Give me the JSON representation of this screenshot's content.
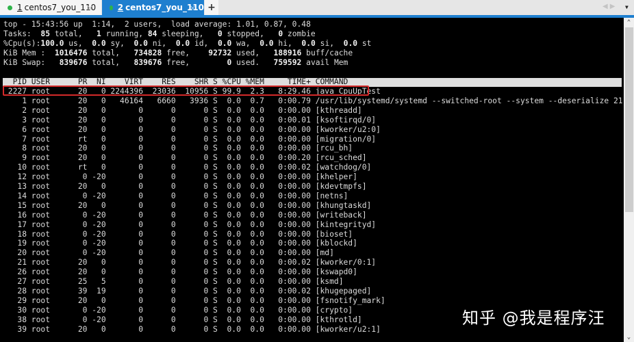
{
  "tabs": [
    {
      "number": "1",
      "label": " centos7_you_110",
      "active": false,
      "close": "×"
    },
    {
      "number": "2",
      "label": " centos7_you_110",
      "active": true,
      "close": "×"
    }
  ],
  "new_tab_label": "+",
  "nav_arrows": "◀▶",
  "menu_caret": "▼",
  "summary": {
    "line1": "top - 15:43:56 up  1:14,  2 users,  load average: 1.01, 0.87, 0.48",
    "tasks": {
      "label": "Tasks: ",
      "total": " 85",
      "total_l": " total, ",
      "running": "  1",
      "running_l": " running, ",
      "sleeping": "84",
      "sleeping_l": " sleeping, ",
      "stopped": "  0",
      "stopped_l": " stopped, ",
      "zombie": "  0",
      "zombie_l": " zombie"
    },
    "cpu": {
      "label": "%Cpu(s):",
      "us": "100.0",
      "us_l": " us, ",
      "sy": " 0.0",
      "sy_l": " sy, ",
      "ni": " 0.0",
      "ni_l": " ni, ",
      "id": " 0.0",
      "id_l": " id, ",
      "wa": " 0.0",
      "wa_l": " wa, ",
      "hi": " 0.0",
      "hi_l": " hi, ",
      "si": " 0.0",
      "si_l": " si, ",
      "st": " 0.0",
      "st_l": " st"
    },
    "mem": {
      "label": "KiB Mem : ",
      "total": " 1016476",
      "total_l": " total, ",
      "free": "  734828",
      "free_l": " free, ",
      "used": "   92732",
      "used_l": " used, ",
      "buff": "  188916",
      "buff_l": " buff/cache"
    },
    "swap": {
      "label": "KiB Swap: ",
      "total": "  839676",
      "total_l": " total, ",
      "free": "  839676",
      "free_l": " free, ",
      "used": "       0",
      "used_l": " used. ",
      "avail": "  759592",
      "avail_l": " avail Mem"
    }
  },
  "columns": [
    "PID",
    "USER",
    "PR",
    "NI",
    "VIRT",
    "RES",
    "SHR",
    "S",
    "%CPU",
    "%MEM",
    "TIME+",
    "COMMAND"
  ],
  "processes": [
    {
      "pid": "2227",
      "user": "root",
      "pr": "20",
      "ni": "0",
      "virt": "2244396",
      "res": "23036",
      "shr": "10956",
      "s": "S",
      "cpu": "99.9",
      "mem": "2.3",
      "time": "8:29.46",
      "command": "java CpuUpTest"
    },
    {
      "pid": "1",
      "user": "root",
      "pr": "20",
      "ni": "0",
      "virt": "46164",
      "res": "6660",
      "shr": "3936",
      "s": "S",
      "cpu": "0.0",
      "mem": "0.7",
      "time": "0:00.79",
      "command": "/usr/lib/systemd/systemd --switched-root --system --deserialize 21"
    },
    {
      "pid": "2",
      "user": "root",
      "pr": "20",
      "ni": "0",
      "virt": "0",
      "res": "0",
      "shr": "0",
      "s": "S",
      "cpu": "0.0",
      "mem": "0.0",
      "time": "0:00.00",
      "command": "[kthreadd]"
    },
    {
      "pid": "3",
      "user": "root",
      "pr": "20",
      "ni": "0",
      "virt": "0",
      "res": "0",
      "shr": "0",
      "s": "S",
      "cpu": "0.0",
      "mem": "0.0",
      "time": "0:00.01",
      "command": "[ksoftirqd/0]"
    },
    {
      "pid": "6",
      "user": "root",
      "pr": "20",
      "ni": "0",
      "virt": "0",
      "res": "0",
      "shr": "0",
      "s": "S",
      "cpu": "0.0",
      "mem": "0.0",
      "time": "0:00.00",
      "command": "[kworker/u2:0]"
    },
    {
      "pid": "7",
      "user": "root",
      "pr": "rt",
      "ni": "0",
      "virt": "0",
      "res": "0",
      "shr": "0",
      "s": "S",
      "cpu": "0.0",
      "mem": "0.0",
      "time": "0:00.00",
      "command": "[migration/0]"
    },
    {
      "pid": "8",
      "user": "root",
      "pr": "20",
      "ni": "0",
      "virt": "0",
      "res": "0",
      "shr": "0",
      "s": "S",
      "cpu": "0.0",
      "mem": "0.0",
      "time": "0:00.00",
      "command": "[rcu_bh]"
    },
    {
      "pid": "9",
      "user": "root",
      "pr": "20",
      "ni": "0",
      "virt": "0",
      "res": "0",
      "shr": "0",
      "s": "S",
      "cpu": "0.0",
      "mem": "0.0",
      "time": "0:00.20",
      "command": "[rcu_sched]"
    },
    {
      "pid": "10",
      "user": "root",
      "pr": "rt",
      "ni": "0",
      "virt": "0",
      "res": "0",
      "shr": "0",
      "s": "S",
      "cpu": "0.0",
      "mem": "0.0",
      "time": "0:00.02",
      "command": "[watchdog/0]"
    },
    {
      "pid": "12",
      "user": "root",
      "pr": "0",
      "ni": "-20",
      "virt": "0",
      "res": "0",
      "shr": "0",
      "s": "S",
      "cpu": "0.0",
      "mem": "0.0",
      "time": "0:00.00",
      "command": "[khelper]"
    },
    {
      "pid": "13",
      "user": "root",
      "pr": "20",
      "ni": "0",
      "virt": "0",
      "res": "0",
      "shr": "0",
      "s": "S",
      "cpu": "0.0",
      "mem": "0.0",
      "time": "0:00.00",
      "command": "[kdevtmpfs]"
    },
    {
      "pid": "14",
      "user": "root",
      "pr": "0",
      "ni": "-20",
      "virt": "0",
      "res": "0",
      "shr": "0",
      "s": "S",
      "cpu": "0.0",
      "mem": "0.0",
      "time": "0:00.00",
      "command": "[netns]"
    },
    {
      "pid": "15",
      "user": "root",
      "pr": "20",
      "ni": "0",
      "virt": "0",
      "res": "0",
      "shr": "0",
      "s": "S",
      "cpu": "0.0",
      "mem": "0.0",
      "time": "0:00.00",
      "command": "[khungtaskd]"
    },
    {
      "pid": "16",
      "user": "root",
      "pr": "0",
      "ni": "-20",
      "virt": "0",
      "res": "0",
      "shr": "0",
      "s": "S",
      "cpu": "0.0",
      "mem": "0.0",
      "time": "0:00.00",
      "command": "[writeback]"
    },
    {
      "pid": "17",
      "user": "root",
      "pr": "0",
      "ni": "-20",
      "virt": "0",
      "res": "0",
      "shr": "0",
      "s": "S",
      "cpu": "0.0",
      "mem": "0.0",
      "time": "0:00.00",
      "command": "[kintegrityd]"
    },
    {
      "pid": "18",
      "user": "root",
      "pr": "0",
      "ni": "-20",
      "virt": "0",
      "res": "0",
      "shr": "0",
      "s": "S",
      "cpu": "0.0",
      "mem": "0.0",
      "time": "0:00.00",
      "command": "[bioset]"
    },
    {
      "pid": "19",
      "user": "root",
      "pr": "0",
      "ni": "-20",
      "virt": "0",
      "res": "0",
      "shr": "0",
      "s": "S",
      "cpu": "0.0",
      "mem": "0.0",
      "time": "0:00.00",
      "command": "[kblockd]"
    },
    {
      "pid": "20",
      "user": "root",
      "pr": "0",
      "ni": "-20",
      "virt": "0",
      "res": "0",
      "shr": "0",
      "s": "S",
      "cpu": "0.0",
      "mem": "0.0",
      "time": "0:00.00",
      "command": "[md]"
    },
    {
      "pid": "21",
      "user": "root",
      "pr": "20",
      "ni": "0",
      "virt": "0",
      "res": "0",
      "shr": "0",
      "s": "S",
      "cpu": "0.0",
      "mem": "0.0",
      "time": "0:00.02",
      "command": "[kworker/0:1]"
    },
    {
      "pid": "26",
      "user": "root",
      "pr": "20",
      "ni": "0",
      "virt": "0",
      "res": "0",
      "shr": "0",
      "s": "S",
      "cpu": "0.0",
      "mem": "0.0",
      "time": "0:00.00",
      "command": "[kswapd0]"
    },
    {
      "pid": "27",
      "user": "root",
      "pr": "25",
      "ni": "5",
      "virt": "0",
      "res": "0",
      "shr": "0",
      "s": "S",
      "cpu": "0.0",
      "mem": "0.0",
      "time": "0:00.00",
      "command": "[ksmd]"
    },
    {
      "pid": "28",
      "user": "root",
      "pr": "39",
      "ni": "19",
      "virt": "0",
      "res": "0",
      "shr": "0",
      "s": "S",
      "cpu": "0.0",
      "mem": "0.0",
      "time": "0:00.02",
      "command": "[khugepaged]"
    },
    {
      "pid": "29",
      "user": "root",
      "pr": "20",
      "ni": "0",
      "virt": "0",
      "res": "0",
      "shr": "0",
      "s": "S",
      "cpu": "0.0",
      "mem": "0.0",
      "time": "0:00.00",
      "command": "[fsnotify_mark]"
    },
    {
      "pid": "30",
      "user": "root",
      "pr": "0",
      "ni": "-20",
      "virt": "0",
      "res": "0",
      "shr": "0",
      "s": "S",
      "cpu": "0.0",
      "mem": "0.0",
      "time": "0:00.00",
      "command": "[crypto]"
    },
    {
      "pid": "38",
      "user": "root",
      "pr": "0",
      "ni": "-20",
      "virt": "0",
      "res": "0",
      "shr": "0",
      "s": "S",
      "cpu": "0.0",
      "mem": "0.0",
      "time": "0:00.00",
      "command": "[kthrotld]"
    },
    {
      "pid": "39",
      "user": "root",
      "pr": "20",
      "ni": "0",
      "virt": "0",
      "res": "0",
      "shr": "0",
      "s": "S",
      "cpu": "0.0",
      "mem": "0.0",
      "time": "0:00.00",
      "command": "[kworker/u2:1]"
    }
  ],
  "highlighted_pid": "2227",
  "watermark": "知乎 @我是程序汪",
  "scrollbar": {
    "up": "⌃",
    "down": "⌄"
  },
  "colors": {
    "accent": "#1e7fcf",
    "highlight_border": "#d42a2a",
    "status_dot": "#2fb34a"
  }
}
